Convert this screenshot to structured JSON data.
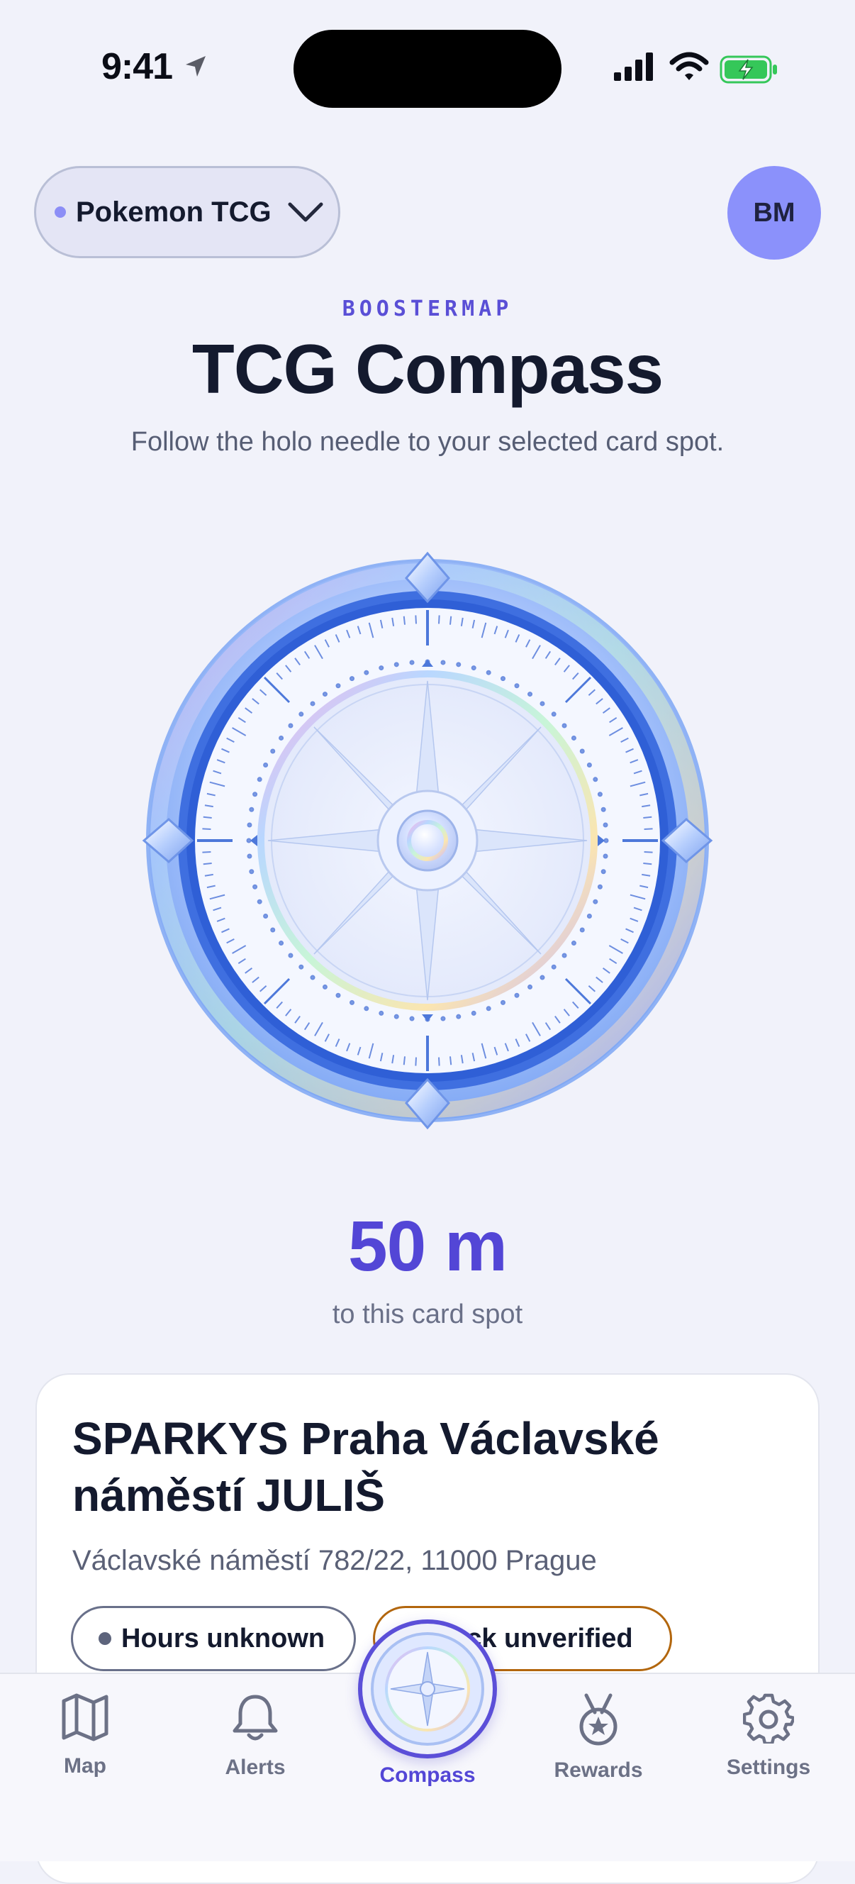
{
  "status_bar": {
    "time": "9:41"
  },
  "header": {
    "game_selector": {
      "label": "Pokemon TCG"
    },
    "avatar_initials": "BM"
  },
  "hero": {
    "eyebrow": "BOOSTERMAP",
    "title": "TCG Compass",
    "subtitle": "Follow the holo needle to your selected card spot."
  },
  "distance": {
    "value": "50 m",
    "caption": "to this card spot"
  },
  "store_card": {
    "name": "SPARKYS Praha Václavské náměstí JULIŠ",
    "address": "Václavské náměstí 782/22, 11000 Prague",
    "badges": [
      {
        "label": "Hours unknown",
        "dot_color": "#5d647c",
        "border_color": "#69708a"
      },
      {
        "label": "Stock unverified",
        "dot_color": "#b2660d",
        "border_color": "#b2660d"
      }
    ]
  },
  "tab_bar": {
    "active_tab": "Compass",
    "tabs": [
      {
        "label": "Map",
        "icon": "map-icon"
      },
      {
        "label": "Alerts",
        "icon": "bell-icon"
      },
      {
        "label": "Compass",
        "icon": "compass-icon"
      },
      {
        "label": "Rewards",
        "icon": "medal-icon"
      },
      {
        "label": "Settings",
        "icon": "gear-icon"
      }
    ]
  },
  "colors": {
    "accent": "#5346d6",
    "avatar": "#8b91fb",
    "background": "#f1f2fa"
  }
}
